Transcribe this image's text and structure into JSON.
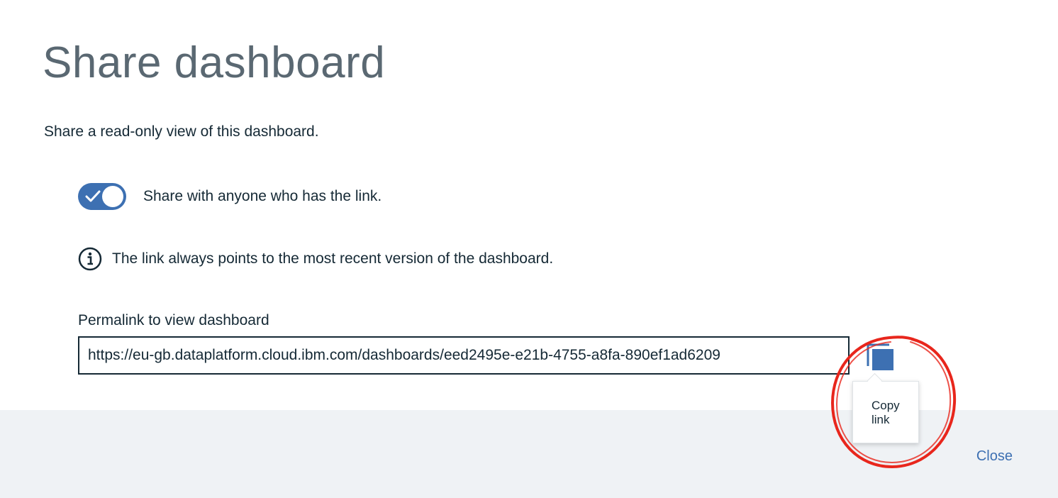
{
  "dialog": {
    "title": "Share dashboard",
    "subtitle": "Share a read-only view of this dashboard.",
    "share_toggle": {
      "label": "Share with anyone who has the link.",
      "enabled": true
    },
    "info_text": "The link always points to the most recent version of the dashboard.",
    "permalink": {
      "label": "Permalink to view dashboard",
      "value": "https://eu-gb.dataplatform.cloud.ibm.com/dashboards/eed2495e-e21b-4755-a8fa-890ef1ad6209"
    },
    "copy_button": {
      "icon": "copy-icon",
      "tooltip": "Copy\nlink"
    },
    "close_label": "Close"
  },
  "colors": {
    "accent": "#3d70b2",
    "text": "#152935",
    "title": "#5a6872",
    "footer_bg": "#eff2f5",
    "annotation": "#e8261c"
  }
}
